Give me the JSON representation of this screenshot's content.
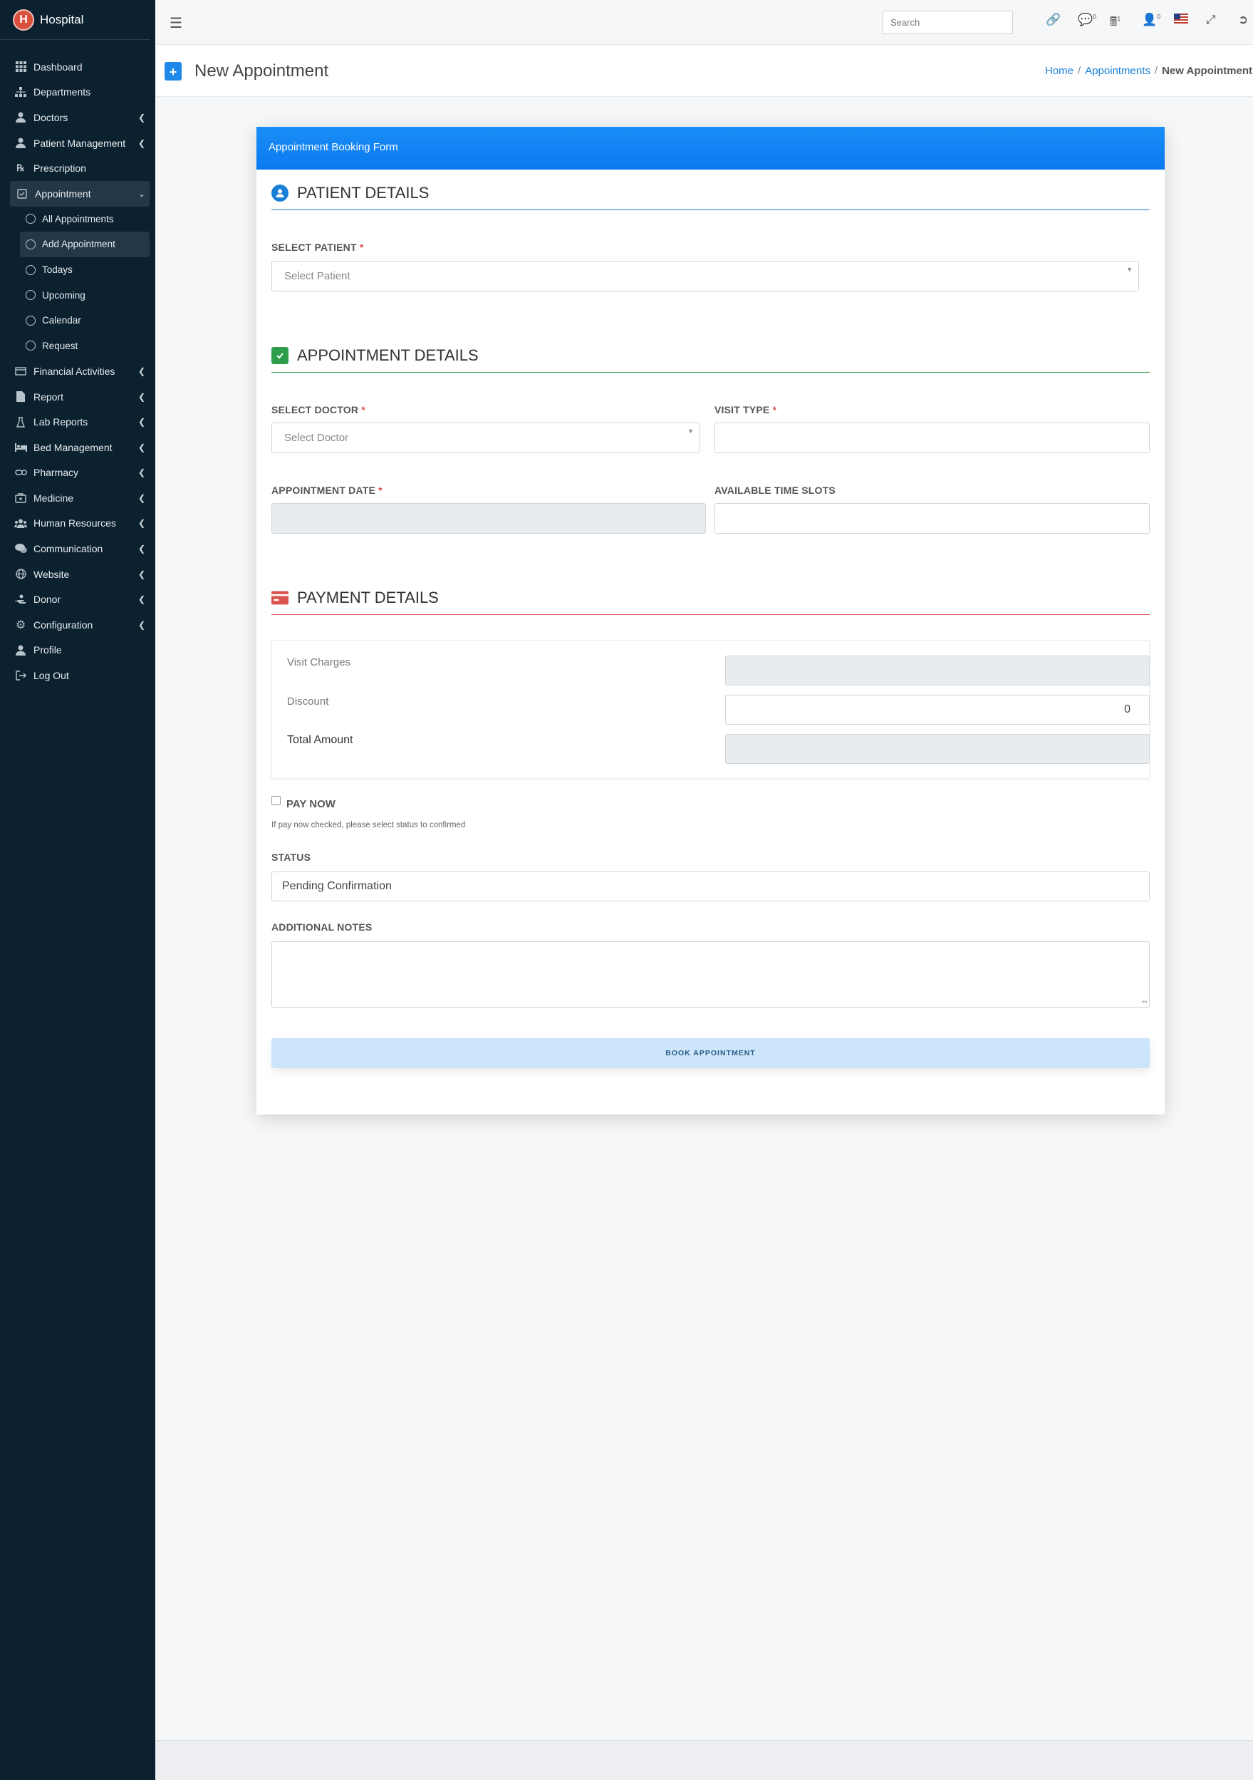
{
  "app": {
    "name": "Hospital"
  },
  "sidebar": {
    "items": [
      {
        "label": "Dashboard",
        "icon": "grid-icon"
      },
      {
        "label": "Departments",
        "icon": "sitemap-icon"
      },
      {
        "label": "Doctors",
        "icon": "doctor-icon",
        "has_children": true
      },
      {
        "label": "Patient Management",
        "icon": "user-icon",
        "has_children": true
      },
      {
        "label": "Prescription",
        "icon": "prescription-icon"
      },
      {
        "label": "Appointment",
        "icon": "calendar-check-icon",
        "expanded": true
      }
    ],
    "sub_items": [
      {
        "label": "All Appointments"
      },
      {
        "label": "Add Appointment"
      },
      {
        "label": "Todays"
      },
      {
        "label": "Upcoming"
      },
      {
        "label": "Calendar"
      },
      {
        "label": "Request"
      }
    ],
    "items_after": [
      {
        "label": "Financial Activities",
        "icon": "money-icon",
        "has_children": true
      },
      {
        "label": "Report",
        "icon": "report-icon",
        "has_children": true
      },
      {
        "label": "Lab Reports",
        "icon": "flask-icon",
        "has_children": true
      },
      {
        "label": "Bed Management",
        "icon": "bed-icon",
        "has_children": true
      },
      {
        "label": "Pharmacy",
        "icon": "pills-icon",
        "has_children": true
      },
      {
        "label": "Medicine",
        "icon": "medkit-icon",
        "has_children": true
      },
      {
        "label": "Human Resources",
        "icon": "users-icon",
        "has_children": true
      },
      {
        "label": "Communication",
        "icon": "comments-icon",
        "has_children": true
      },
      {
        "label": "Website",
        "icon": "globe-icon",
        "has_children": true
      },
      {
        "label": "Donor",
        "icon": "hand-holding-icon",
        "has_children": true
      },
      {
        "label": "Configuration",
        "icon": "gear-icon",
        "has_children": true
      },
      {
        "label": "Profile",
        "icon": "user-icon"
      },
      {
        "label": "Log Out",
        "icon": "logout-icon"
      }
    ]
  },
  "topbar": {
    "search_placeholder": "Search",
    "messages_count": "0",
    "calc_count": "1",
    "users_count": "0"
  },
  "header": {
    "title": "New Appointment",
    "breadcrumb": [
      "Home",
      "Appointments",
      "New Appointment"
    ]
  },
  "form": {
    "card_title": "Appointment Booking Form",
    "patient_section": "PATIENT DETAILS",
    "select_patient_label": "SELECT PATIENT",
    "select_patient_placeholder": "Select Patient",
    "appointment_section": "APPOINTMENT DETAILS",
    "select_doctor_label": "SELECT DOCTOR",
    "select_doctor_placeholder": "Select Doctor",
    "visit_type_label": "VISIT TYPE",
    "appointment_date_label": "APPOINTMENT DATE",
    "time_slots_label": "AVAILABLE TIME SLOTS",
    "payment_section": "PAYMENT DETAILS",
    "visit_charges_label": "Visit Charges",
    "discount_label": "Discount",
    "discount_value": "0",
    "total_amount_label": "Total Amount",
    "pay_now_label": "PAY NOW",
    "pay_now_hint": "If pay now checked, please select status to confirmed",
    "status_label": "STATUS",
    "status_value": "Pending Confirmation",
    "notes_label": "ADDITIONAL NOTES",
    "submit_label": "BOOK APPOINTMENT",
    "required_mark": "*"
  },
  "colors": {
    "sidebar_bg": "#0b2130",
    "primary": "#1a8ef7",
    "patient_accent": "#1a7fd6",
    "appointment_accent": "#2e9e4d",
    "payment_accent": "#d9534f"
  }
}
